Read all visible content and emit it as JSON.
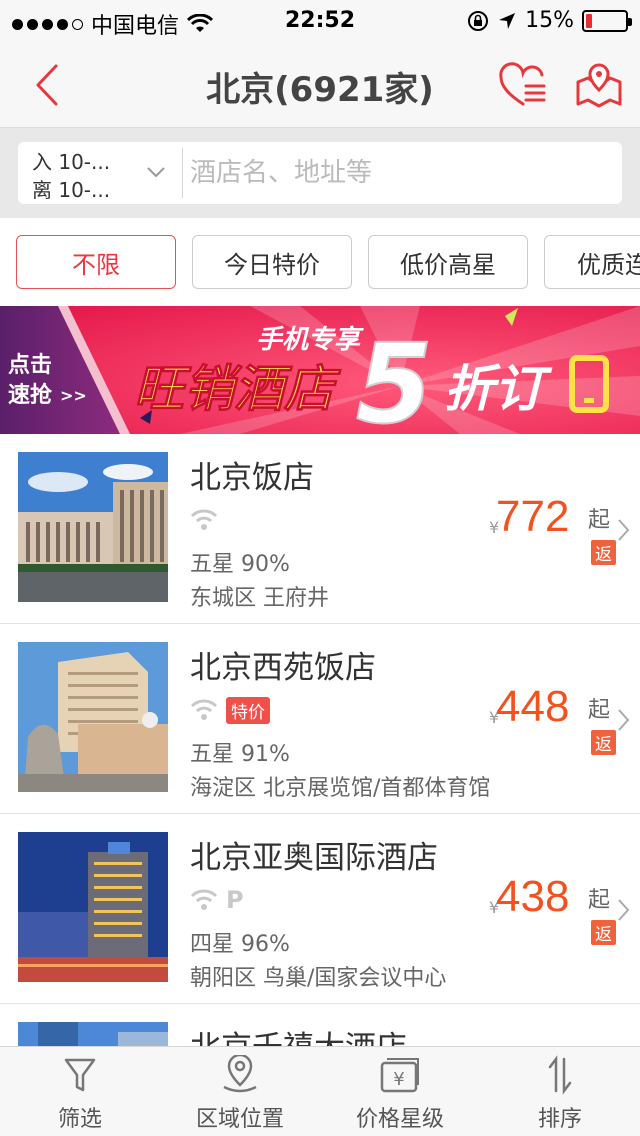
{
  "status_bar": {
    "carrier": "中国电信",
    "time": "22:52",
    "battery_percent": "15%",
    "battery_level": 0.15
  },
  "nav": {
    "title": "北京(6921家)",
    "back_icon": "chevron-left-icon",
    "favorites_icon": "heart-list-icon",
    "map_icon": "map-pin-icon",
    "accent_color": "#e8383d"
  },
  "search": {
    "checkin": "入 10-...",
    "checkout": "离 10-...",
    "placeholder": "酒店名、地址等",
    "value": ""
  },
  "filters": [
    {
      "label": "不限",
      "active": true
    },
    {
      "label": "今日特价",
      "active": false
    },
    {
      "label": "低价高星",
      "active": false
    },
    {
      "label": "优质连",
      "active": false
    }
  ],
  "banner": {
    "left_line1": "点击",
    "left_line2": "速抢",
    "left_arrow": ">>",
    "subtitle": "手机专享",
    "headline": "旺销酒店",
    "number": "5",
    "discount": "折订"
  },
  "hotels": [
    {
      "name": "北京饭店",
      "amenities": [
        "wifi"
      ],
      "tag": "",
      "rating": "五星  90%",
      "area": "东城区  王府井",
      "currency": "¥",
      "price": "772",
      "price_suffix": "起",
      "rebate": "返"
    },
    {
      "name": "北京西苑饭店",
      "amenities": [
        "wifi"
      ],
      "tag": "特价",
      "rating": "五星  91%",
      "area": "海淀区  北京展览馆/首都体育馆",
      "currency": "¥",
      "price": "448",
      "price_suffix": "起",
      "rebate": "返"
    },
    {
      "name": "北京亚奥国际酒店",
      "amenities": [
        "wifi",
        "parking"
      ],
      "parking_label": "P",
      "tag": "",
      "rating": "四星  96%",
      "area": "朝阳区  鸟巢/国家会议中心",
      "currency": "¥",
      "price": "438",
      "price_suffix": "起",
      "rebate": "返"
    },
    {
      "name": "北京千禧大酒店",
      "amenities": [],
      "tag": "",
      "rating": "",
      "area": "",
      "currency": "",
      "price": "",
      "price_suffix": "",
      "rebate": ""
    }
  ],
  "tabs": [
    {
      "label": "筛选",
      "icon": "filter-icon"
    },
    {
      "label": "区域位置",
      "icon": "location-icon"
    },
    {
      "label": "价格星级",
      "icon": "price-tag-icon"
    },
    {
      "label": "排序",
      "icon": "sort-icon"
    }
  ],
  "colors": {
    "price": "#f2521e",
    "rebate_bg": "#f0623c",
    "promo_tag_bg": "#f0504a",
    "banner_bg": "#f5335e"
  }
}
